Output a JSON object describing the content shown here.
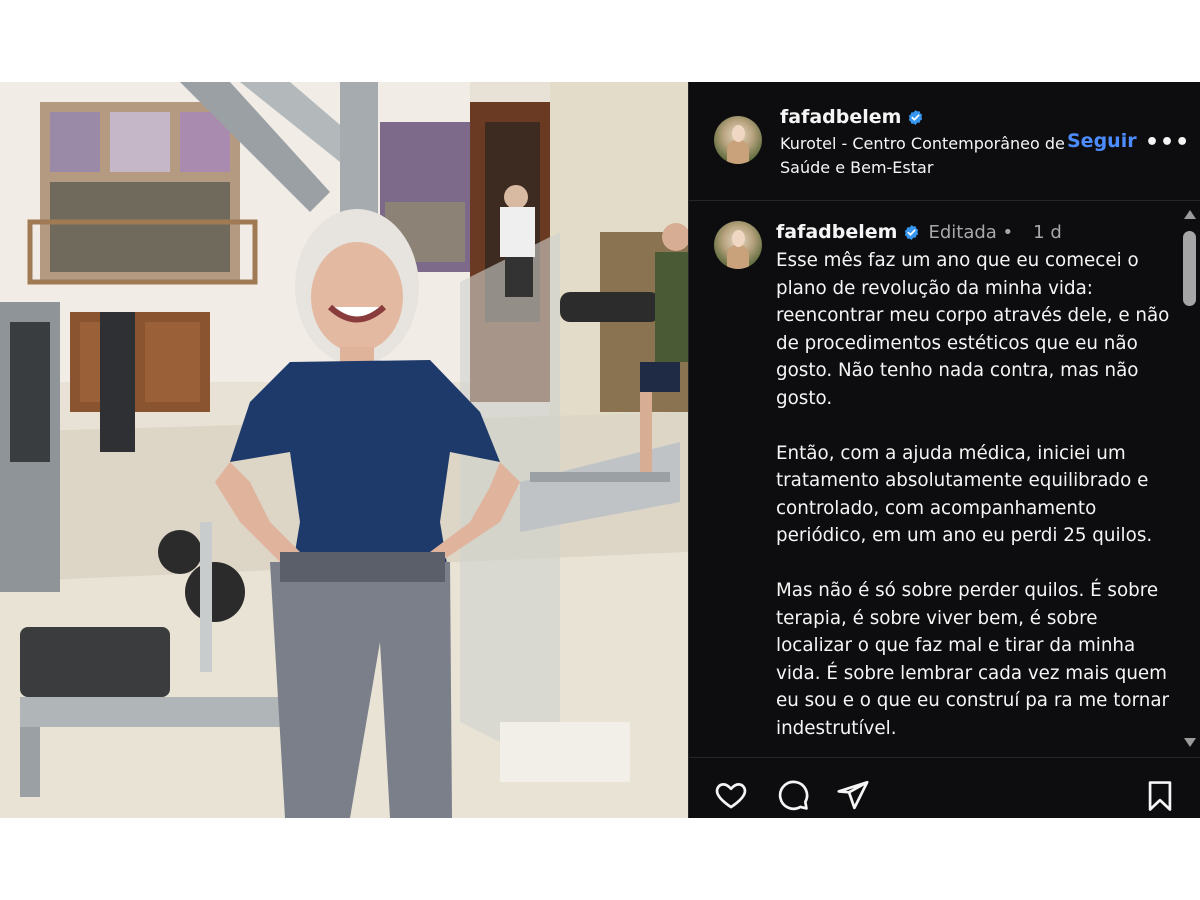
{
  "post": {
    "author": {
      "username": "fafadbelem",
      "verified": true,
      "avatar_icon": "profile-avatar"
    },
    "location": "Kurotel - Centro Contemporâneo de Saúde e Bem-Estar",
    "follow_label": "Seguir",
    "more_label": "•••",
    "caption": {
      "username": "fafadbelem",
      "edited_label": "Editada •",
      "time": "1 d",
      "text": "Esse mês faz um ano que eu comecei o plano de revolução da minha vida: reencontrar meu corpo através dele, e não de procedimentos estéticos que eu não gosto. Não tenho nada contra, mas não gosto.\n\nEntão, com a ajuda médica, iniciei um tratamento absolutamente equilibrado e controlado, com acompanhamento periódico, em um ano eu perdi 25 quilos.\n\nMas não é só sobre perder quilos. É sobre terapia, é sobre viver bem, é sobre localizar o que faz mal e tirar da minha vida. É sobre lembrar cada vez mais quem eu sou e o que eu construí pa ra me tornar indestrutível."
    },
    "actions": {
      "like_icon": "heart-icon",
      "comment_icon": "comment-icon",
      "share_icon": "share-icon",
      "save_icon": "bookmark-icon"
    },
    "colors": {
      "panel_bg": "#0d0d0f",
      "accent": "#4d8cff",
      "verified": "#3797f0",
      "muted": "#a8a8a8"
    }
  }
}
